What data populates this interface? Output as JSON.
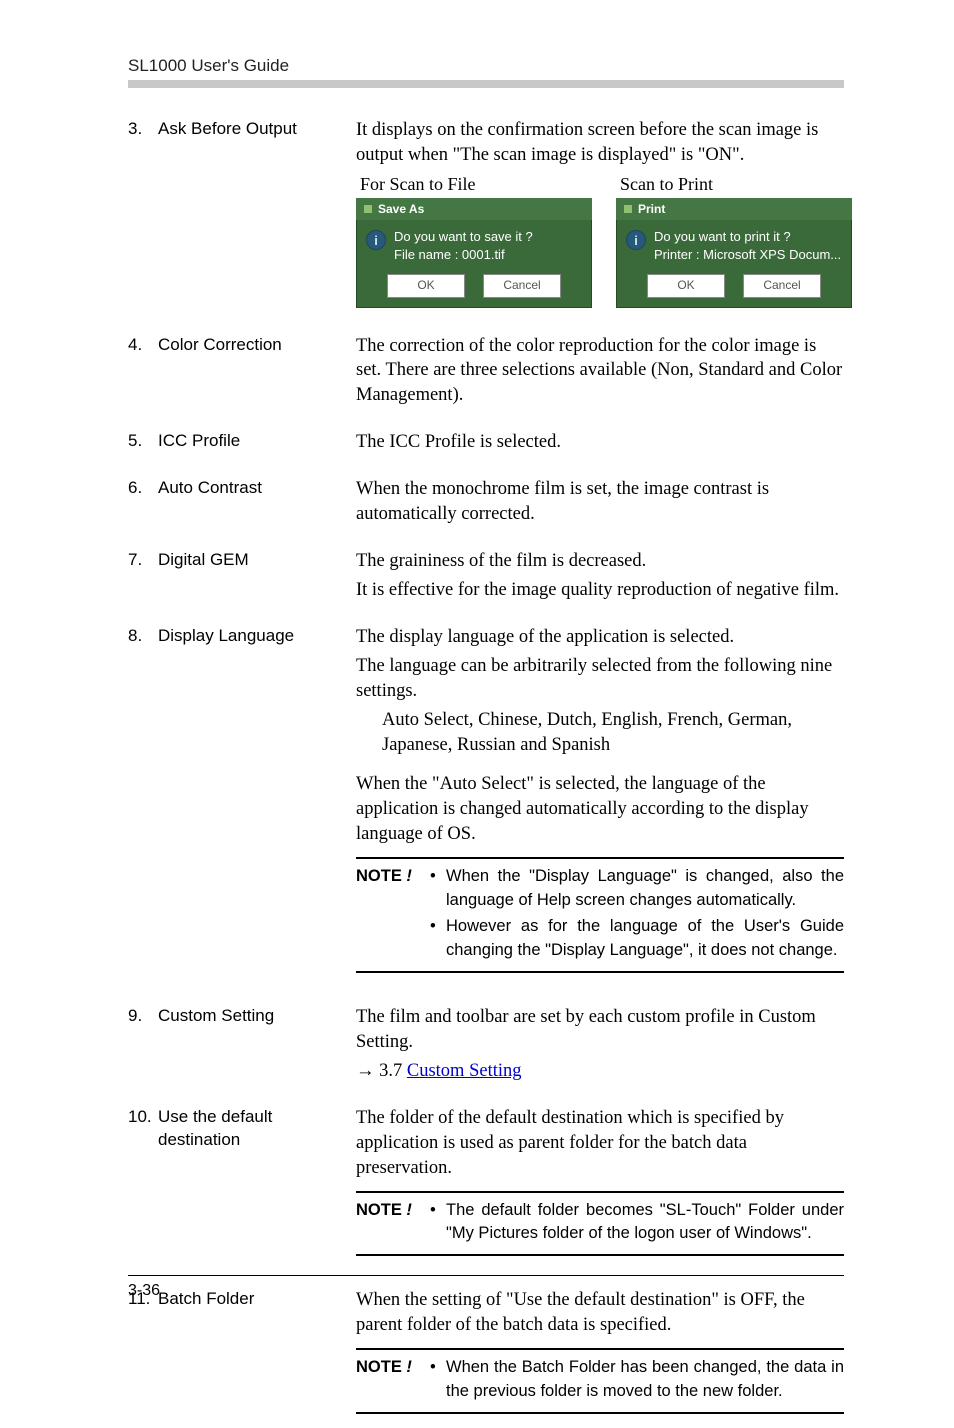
{
  "header": "SL1000 User's Guide",
  "items": [
    {
      "num": "3.",
      "label": "Ask Before Output",
      "pre_text": [
        "It displays on the confirmation screen before the scan image is output when \"The scan image is displayed\" is \"ON\"."
      ],
      "dialogs": {
        "left": {
          "caption": "For Scan to File",
          "title": "Save As",
          "line1": "Do you want to save it ?",
          "line2": "File name : 0001.tif",
          "ok": "OK",
          "cancel": "Cancel"
        },
        "right": {
          "caption": "Scan to Print",
          "title": "Print",
          "line1": "Do you want to print it ?",
          "line2": "Printer : Microsoft XPS Docum...",
          "ok": "OK",
          "cancel": "Cancel"
        }
      }
    },
    {
      "num": "4.",
      "label": "Color Correction",
      "text": [
        "The correction of the color reproduction for the color image is set. There are three selections available (Non, Standard and Color Management)."
      ]
    },
    {
      "num": "5.",
      "label": "ICC Profile",
      "text": [
        "The ICC Profile is selected."
      ]
    },
    {
      "num": "6.",
      "label": "Auto Contrast",
      "text": [
        "When the monochrome film is set, the image contrast is automatically corrected."
      ]
    },
    {
      "num": "7.",
      "label": "Digital GEM",
      "text": [
        "The graininess of the film is decreased.",
        "It is effective for the image quality reproduction of negative film."
      ]
    },
    {
      "num": "8.",
      "label": "Display Language",
      "text": [
        "The display language of the application is selected.",
        "The language can be arbitrarily selected from the following nine settings."
      ],
      "indent": [
        "Auto Select, Chinese, Dutch, English, French, German, Japanese, Russian and Spanish"
      ],
      "text2": [
        "When the \"Auto Select\" is selected, the language of the application is changed automatically according to the display language of OS."
      ],
      "note": [
        "When the \"Display Language\" is changed, also the language of Help screen changes automatically.",
        "However as for the language of the User's Guide changing the \"Display Language\", it does not change."
      ]
    },
    {
      "num": "9.",
      "label": "Custom Setting",
      "text_rich": {
        "pre": "The film and toolbar are set by each custom profile in Custom Setting.",
        "arrow": "→ 3.7 ",
        "link": "Custom Setting"
      }
    },
    {
      "num": "10.",
      "label": "Use the default destination",
      "text": [
        "The folder of the default destination which is specified by application is used as parent folder for the batch data preservation."
      ],
      "note": [
        "The default folder becomes \"SL-Touch\" Folder under \"My Pictures folder of the logon user of Windows\"."
      ]
    },
    {
      "num": "11.",
      "label": "Batch Folder",
      "text": [
        "When the setting of \"Use the default destination\" is OFF, the parent folder of the batch data is specified."
      ],
      "note": [
        "When the Batch Folder has been changed, the data in the previous folder is moved to the new folder."
      ]
    }
  ],
  "note_label_b": "NOTE",
  "note_label_i": " !",
  "footer_page": "3-36"
}
